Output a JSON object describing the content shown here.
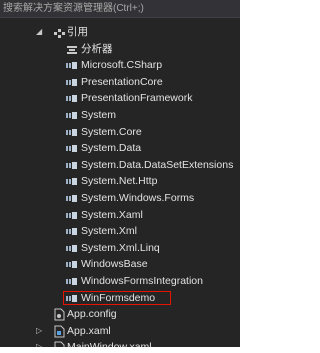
{
  "search": {
    "placeholder": "搜索解决方案资源管理器(Ctrl+;)"
  },
  "tree": {
    "references_label": "引用",
    "analyzers_label": "分析器",
    "references": [
      "Microsoft.CSharp",
      "PresentationCore",
      "PresentationFramework",
      "System",
      "System.Core",
      "System.Data",
      "System.Data.DataSetExtensions",
      "System.Net.Http",
      "System.Windows.Forms",
      "System.Xaml",
      "System.Xml",
      "System.Xml.Linq",
      "WindowsBase",
      "WindowsFormsIntegration",
      "WinFormsdemo"
    ],
    "files": [
      "App.config",
      "App.xaml",
      "MainWindow.xaml"
    ]
  },
  "colors": {
    "panel_bg": "#252526",
    "highlight_border": "#e51400",
    "assembly_icon": "#9fb3c8"
  }
}
